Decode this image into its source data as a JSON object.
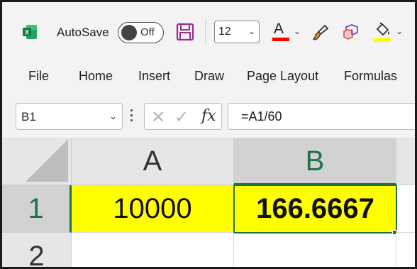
{
  "toolbar": {
    "autosave_label": "AutoSave",
    "autosave_state": "Off",
    "font_size": "12",
    "font_color_letter": "A",
    "font_color": "#ff0000",
    "fill_color": "#ffff00",
    "icons": [
      "excel-logo-icon",
      "save-icon",
      "font-color-icon",
      "format-painter-icon",
      "cube-icon",
      "fill-color-icon"
    ]
  },
  "tabs": [
    "File",
    "Home",
    "Insert",
    "Draw",
    "Page Layout",
    "Formulas"
  ],
  "formula_bar": {
    "name_box": "B1",
    "fx_label": "fx",
    "formula": "=A1/60"
  },
  "sheet": {
    "columns": [
      "A",
      "B"
    ],
    "rows": [
      "1",
      "2"
    ],
    "cells": {
      "A1": "10000",
      "B1": "166.6667"
    },
    "active_cell": "B1",
    "accent_color": "#217346"
  }
}
